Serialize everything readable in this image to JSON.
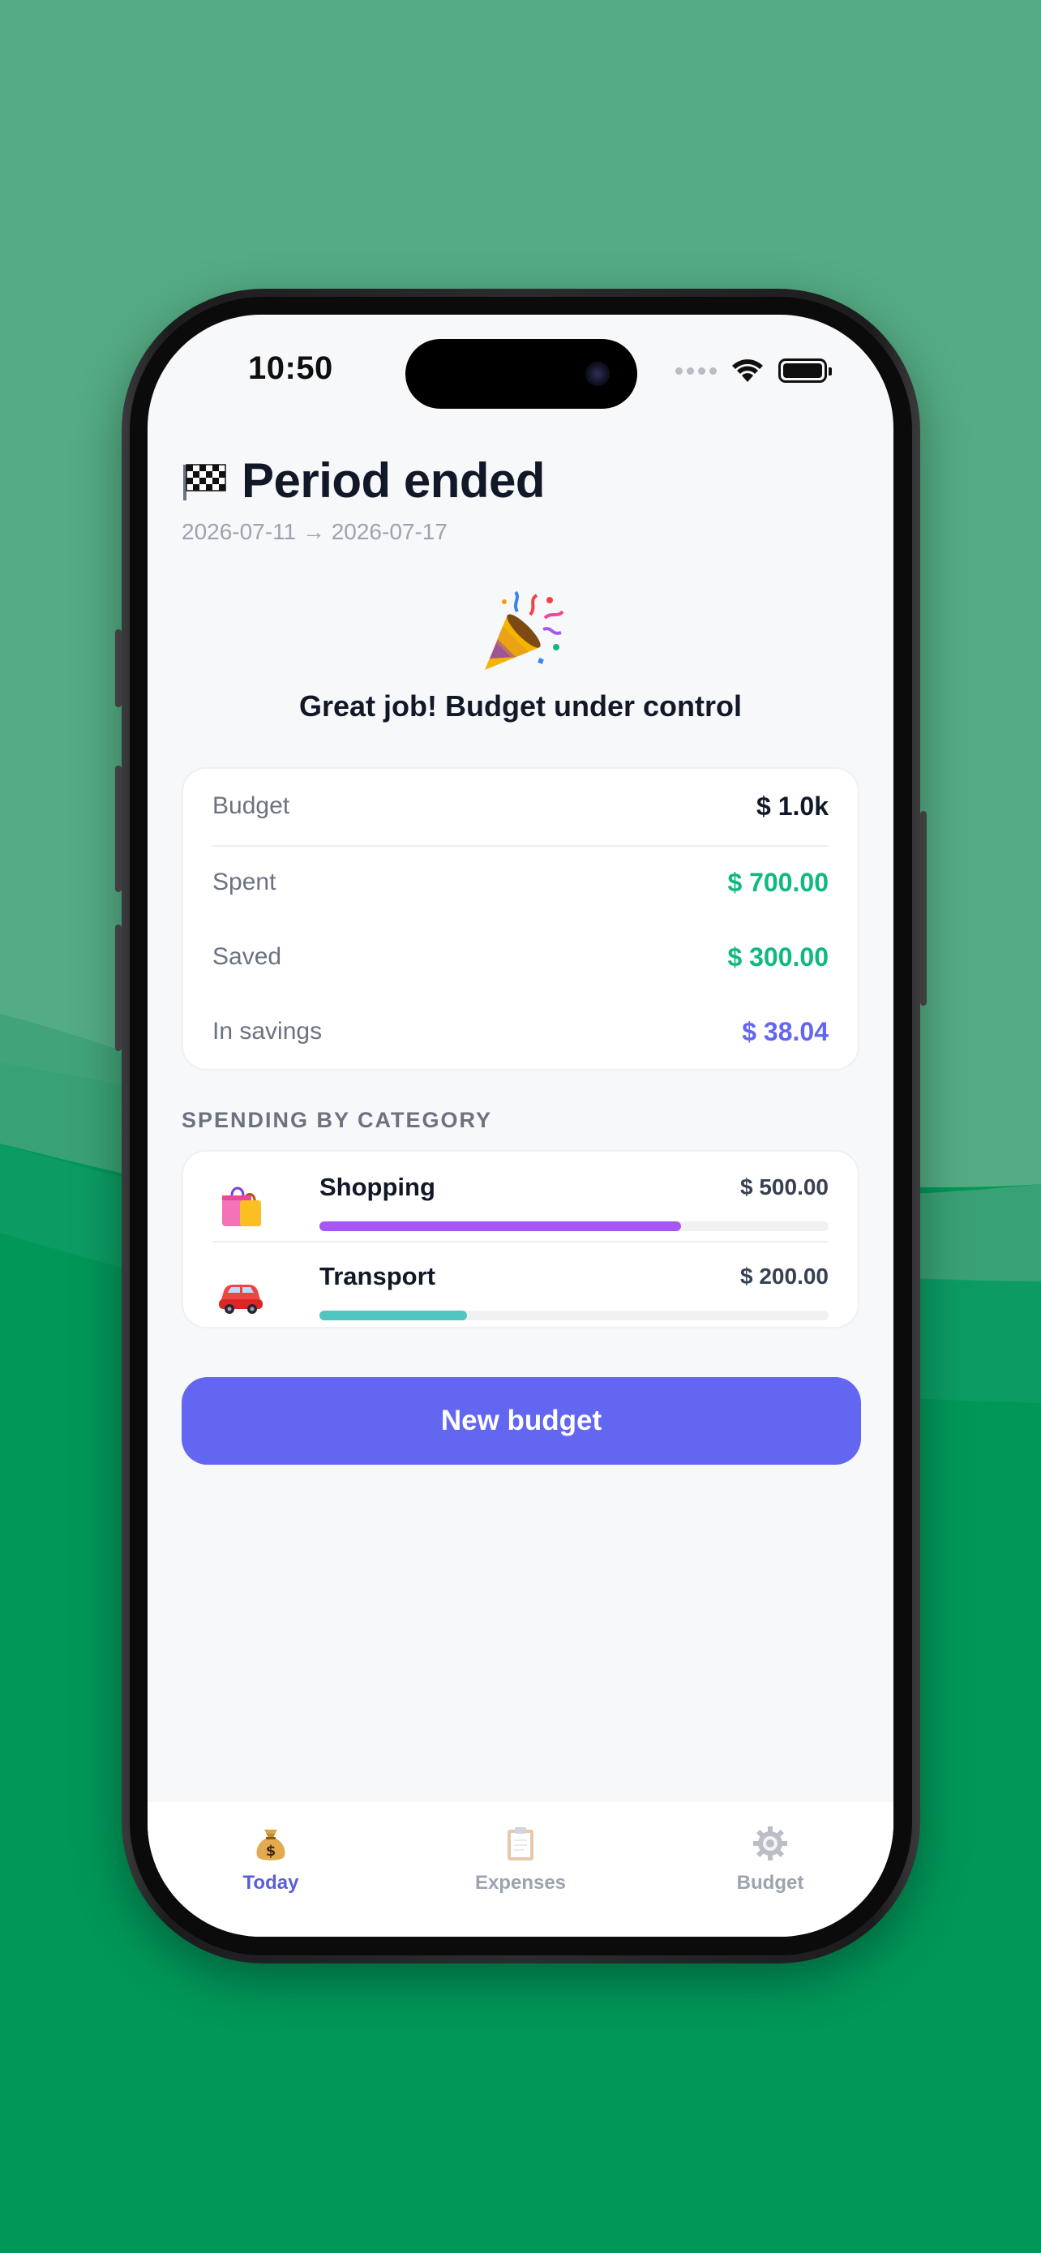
{
  "status_bar": {
    "time": "10:50"
  },
  "header": {
    "title": "Period ended",
    "period_range": "2026-07-11 → 2026-07-17",
    "flag_icon": "checkered-flag-icon"
  },
  "celebration": {
    "icon": "party-popper-icon",
    "headline": "Great job! Budget under control"
  },
  "summary": {
    "rows": [
      {
        "label": "Budget",
        "value": "$ 1.0k",
        "color": "#111827"
      },
      {
        "label": "Spent",
        "value": "$ 700.00",
        "color": "#10b981"
      },
      {
        "label": "Saved",
        "value": "$ 300.00",
        "color": "#10b981"
      },
      {
        "label": "In savings",
        "value": "$ 38.04",
        "color": "#6366f1"
      }
    ]
  },
  "spending": {
    "section_title": "SPENDING BY CATEGORY",
    "categories": [
      {
        "name": "Shopping",
        "amount": "$ 500.00",
        "icon": "shopping-bags-icon",
        "share": 0.71,
        "color": "#a855f7"
      },
      {
        "name": "Transport",
        "amount": "$ 200.00",
        "icon": "car-icon",
        "share": 0.29,
        "color": "#4fc7c0"
      }
    ]
  },
  "actions": {
    "new_budget_label": "New budget"
  },
  "tab_bar": {
    "tabs": [
      {
        "label": "Today",
        "icon": "money-bag-icon",
        "active": true
      },
      {
        "label": "Expenses",
        "icon": "clipboard-icon",
        "active": false
      },
      {
        "label": "Budget",
        "icon": "gear-icon",
        "active": false
      }
    ],
    "active_color": "#5b5fd6",
    "inactive_color": "#9ca3af"
  }
}
